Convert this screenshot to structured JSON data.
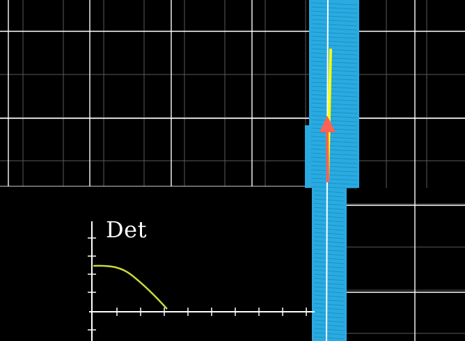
{
  "graph": {
    "label": "Det"
  },
  "colors": {
    "background": "#000000",
    "grid_major": "#ffffff",
    "grid_minor": "#5a5a5a",
    "squished_plane": "#29abe2",
    "squished_plane_hatch": "#0f7fa8",
    "basis_i_hat": "#ffff00",
    "basis_j_hat": "#fc6255",
    "curve": "#c8d93a",
    "axes": "#ffffff"
  }
}
